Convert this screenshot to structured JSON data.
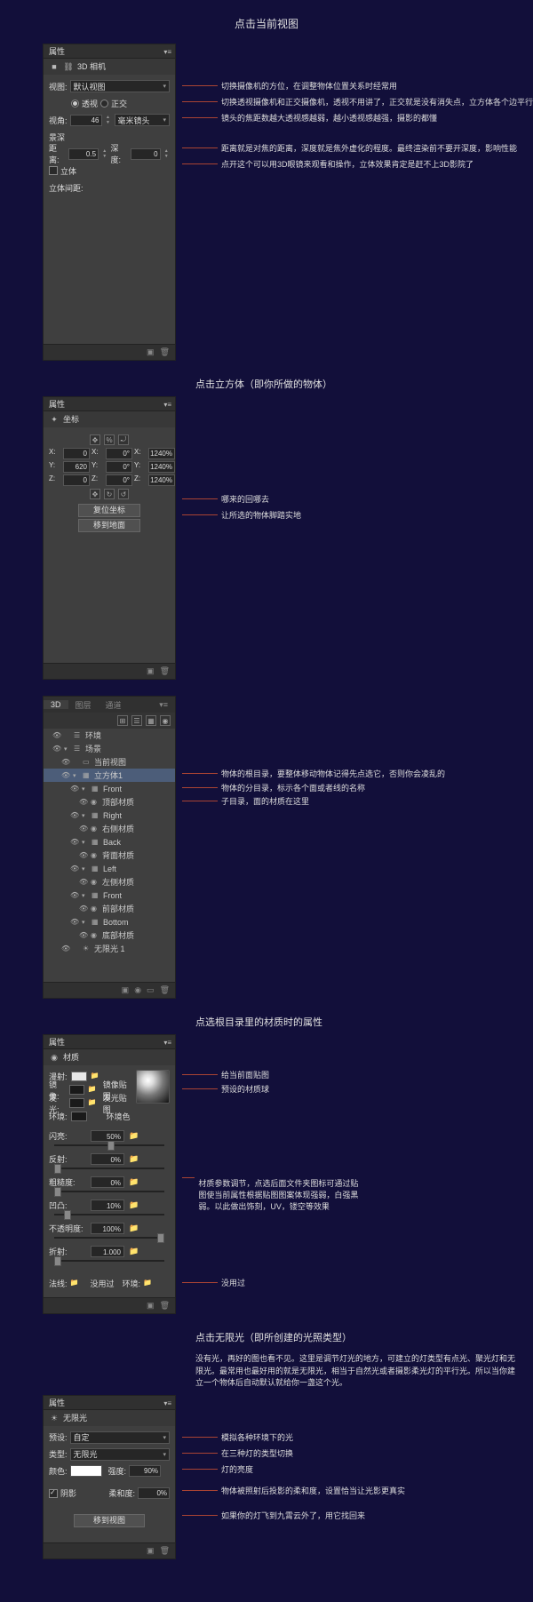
{
  "titles": {
    "t1": "点击当前视图",
    "t2": "点击立方体（即你所做的物体）",
    "t3": "点选根目录里的材质时的属性",
    "t4": "点击无限光（即所创建的光照类型）"
  },
  "common": {
    "properties": "属性"
  },
  "camera": {
    "title": "3D 相机",
    "view_lbl": "视图:",
    "view_val": "默认视图",
    "persp": "透视",
    "ortho": "正交",
    "fov_lbl": "视角:",
    "fov_val": "46",
    "fov_unit": "毫米镜头",
    "depth_lbl": "景深",
    "dist_lbl": "距离:",
    "dist_val": "0.5",
    "deep_lbl": "深度:",
    "deep_val": "0",
    "stereo": "立体",
    "stereo_spacing": "立体间距:",
    "ann_view": "切换摄像机的方位，在调整物体位置关系时经常用",
    "ann_proj": "切换透视摄像机和正交摄像机，透视不用讲了，正交就是没有消失点，立方体各个边平行",
    "ann_fov": "镜头的焦距数越大透视感越弱，越小透视感越强，摄影的都懂",
    "ann_depth1": "距离就是对焦的距离，深度就是焦外虚化的程度。最终渲染前不要开深度，影响性能",
    "ann_depth2": "点开这个可以用3D眼镜来观看和操作，立体效果肯定是赶不上3D影院了"
  },
  "coord": {
    "title": "坐标",
    "x": "X:",
    "y": "Y:",
    "z": "Z:",
    "vx": "0",
    "vy": "620",
    "vz": "0",
    "rx": "0°",
    "ry": "0°",
    "rz": "0°",
    "sx": "1240%",
    "sy": "1240%",
    "sz": "1240%",
    "btn_reset": "复位坐标",
    "btn_ground": "移到地面",
    "ann_reset": "哪来的回哪去",
    "ann_ground": "让所选的物体脚踏实地"
  },
  "scene": {
    "tab_3d": "3D",
    "tab_layers": "图层",
    "tab_channels": "通道",
    "env": "环境",
    "scene": "场景",
    "curview": "当前视图",
    "cube": "立方体1",
    "front": "Front",
    "right": "Right",
    "back": "Back",
    "left": "Left",
    "bottom": "Bottom",
    "top_mat": "顶部材质",
    "right_mat": "右侧材质",
    "back_mat": "背面材质",
    "left_mat": "左侧材质",
    "front_mat": "前部材质",
    "bottom_mat": "底部材质",
    "light": "无限光 1",
    "ann_root": "物体的根目录，要整体移动物体记得先点选它，否则你会凌乱的",
    "ann_face": "物体的分目录，标示各个面或者线的名称",
    "ann_mat": "子目录，面的材质在这里"
  },
  "material": {
    "title": "材质",
    "diffuse": "漫射:",
    "specular": "镜像:",
    "glow": "发光:",
    "ambient": "环境:",
    "spec_tex": "镜像贴图",
    "glow_tex": "发光贴图",
    "amb_color": "环境色",
    "ann_diffuse": "给当前面贴图",
    "ann_sphere": "预设的材质球",
    "shine": "闪亮:",
    "reflect": "反射:",
    "rough": "粗糙度:",
    "bump": "凹凸:",
    "opacity": "不透明度:",
    "refract": "折射:",
    "v_shine": "50%",
    "v_reflect": "0%",
    "v_rough": "0%",
    "v_bump": "10%",
    "v_opacity": "100%",
    "v_refract": "1.000",
    "normal": "法线:",
    "noused": "没用过",
    "env": "环境:",
    "ann_sliders": "材质参数调节，点选后面文件夹图标可通过贴图使当前属性根据贴图图案体现强弱，白强黑弱。以此做出饰刻，UV，镂空等效果"
  },
  "light": {
    "title": "无限光",
    "preset": "预设:",
    "preset_val": "自定",
    "type": "类型:",
    "type_val": "无限光",
    "color": "颜色:",
    "intensity": "强度:",
    "intensity_val": "90%",
    "shadow": "阴影",
    "soft": "柔和度:",
    "soft_val": "0%",
    "moveview": "移到视图",
    "desc": "没有光，再好的图也看不见。这里是调节灯光的地方，可建立的灯类型有点光、聚光灯和无限光。最常用也最好用的就是无限光，相当于自然光或者摄影柔光灯的平行光。所以当你建立一个物体后自动默认就给你一盏这个光。",
    "ann_preset": "模拟各种环境下的光",
    "ann_type": "在三种灯的类型切换",
    "ann_int": "灯的亮度",
    "ann_shadow": "物体被照射后投影的柔和度，设置恰当让光影更真实",
    "ann_move": "如果你的灯飞到九霄云外了，用它找回来"
  }
}
